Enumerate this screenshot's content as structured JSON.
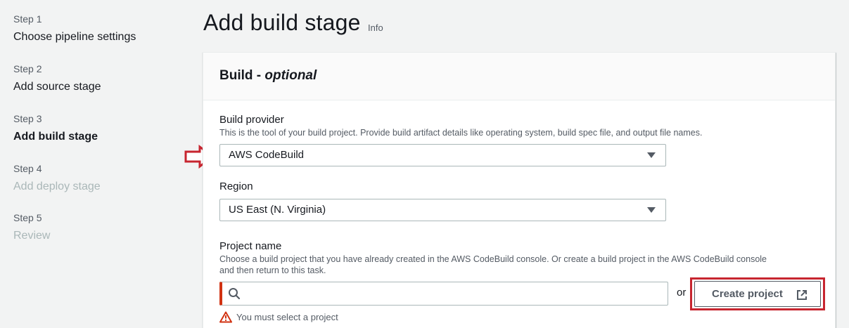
{
  "steps": [
    {
      "number": "Step 1",
      "label": "Choose pipeline settings",
      "state": "done"
    },
    {
      "number": "Step 2",
      "label": "Add source stage",
      "state": "done"
    },
    {
      "number": "Step 3",
      "label": "Add build stage",
      "state": "current"
    },
    {
      "number": "Step 4",
      "label": "Add deploy stage",
      "state": "disabled"
    },
    {
      "number": "Step 5",
      "label": "Review",
      "state": "disabled"
    }
  ],
  "page": {
    "title": "Add build stage",
    "info_link": "Info"
  },
  "panel": {
    "title": "Build - ",
    "title_optional": "optional"
  },
  "build_provider": {
    "label": "Build provider",
    "description": "This is the tool of your build project. Provide build artifact details like operating system, build spec file, and output file names.",
    "value": "AWS CodeBuild"
  },
  "region": {
    "label": "Region",
    "value": "US East (N. Virginia)"
  },
  "project_name": {
    "label": "Project name",
    "description_line1": "Choose a build project that you have already created in the AWS CodeBuild console. Or create a build project in the AWS CodeBuild console",
    "description_line2": "and then return to this task.",
    "value": "",
    "or_text": "or",
    "create_button": "Create project",
    "error": "You must select a project"
  },
  "colors": {
    "accent_red": "#c7252f",
    "error_red": "#d13212",
    "text": "#16191f",
    "muted": "#545b64"
  },
  "icons": {
    "search": "search-icon",
    "external_link": "external-link-icon",
    "warning": "warning-icon",
    "caret": "caret-down-icon",
    "annotation_arrow": "arrow-right-icon"
  }
}
